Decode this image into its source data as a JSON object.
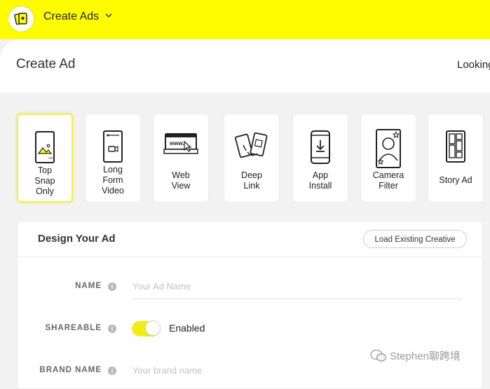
{
  "topbar": {
    "title": "Create Ads",
    "color": "#fffc00"
  },
  "header": {
    "title": "Create Ad",
    "right_text": "Looking"
  },
  "ad_types": [
    {
      "label": "Top\nSnap\nOnly",
      "icon": "top-snap-phone-icon",
      "selected": true
    },
    {
      "label": "Long\nForm\nVideo",
      "icon": "long-form-video-icon",
      "selected": false
    },
    {
      "label": "Web\nView",
      "icon": "web-view-browser-icon",
      "selected": false
    },
    {
      "label": "Deep\nLink",
      "icon": "deep-link-phones-icon",
      "selected": false
    },
    {
      "label": "App\nInstall",
      "icon": "app-install-download-icon",
      "selected": false
    },
    {
      "label": "Camera\nFilter",
      "icon": "camera-filter-icon",
      "selected": false
    },
    {
      "label": "Story Ad",
      "icon": "story-ad-tiles-icon",
      "selected": false
    }
  ],
  "design": {
    "title": "Design Your Ad",
    "load_button": "Load Existing Creative",
    "name_label": "NAME",
    "name_placeholder": "Your Ad Name",
    "shareable_label": "SHAREABLE",
    "shareable_state": "Enabled",
    "brand_label": "BRAND NAME",
    "brand_placeholder": "Your brand name"
  },
  "watermark": "Stephen聊跨境"
}
